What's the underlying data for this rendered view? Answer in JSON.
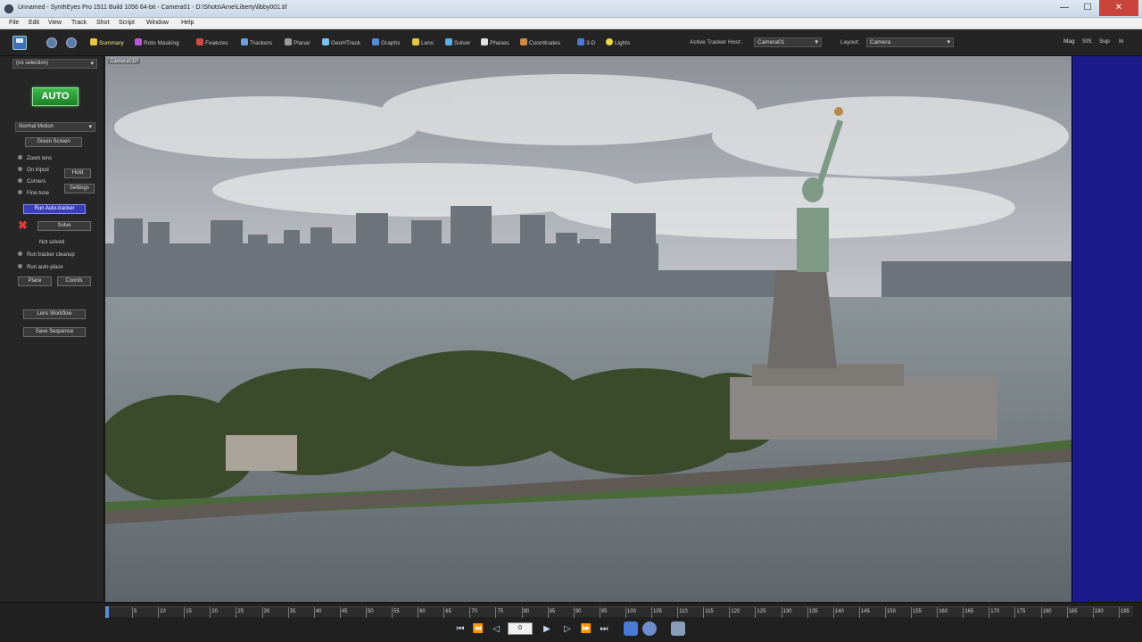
{
  "titlebar": {
    "title": "Unnamed - SynthEyes Pro 1511 Build 1056 64-bit - Camera01 - D:\\Shots\\Arne\\Liberty\\libby001.tif",
    "minimize": "—",
    "maximize": "☐",
    "close": "✕"
  },
  "menu": [
    "File",
    "Edit",
    "View",
    "Track",
    "Shot",
    "Script",
    "Window",
    "Help"
  ],
  "toolbar": {
    "rooms": [
      {
        "label": "Summary",
        "icon": "summary-icon",
        "color": "#e8c64a"
      },
      {
        "label": "Roto Masking",
        "icon": "roto-icon",
        "color": "#b85ad6"
      },
      {
        "label": "Features",
        "icon": "features-icon",
        "color": "#d04a4a"
      },
      {
        "label": "Trackers",
        "icon": "trackers-icon",
        "color": "#6aa0e0"
      },
      {
        "label": "Planar",
        "icon": "planar-icon",
        "color": "#9a9a9a"
      },
      {
        "label": "GeoHTrack",
        "icon": "geohtrack-icon",
        "color": "#7ac0e8"
      },
      {
        "label": "Graphs",
        "icon": "graphs-icon",
        "color": "#5a8ad6"
      },
      {
        "label": "Lens",
        "icon": "lens-icon",
        "color": "#e0c84a"
      },
      {
        "label": "Solver",
        "icon": "solver-icon",
        "color": "#5ab0e0"
      },
      {
        "label": "Phases",
        "icon": "phases-icon",
        "color": "#e0e0e0"
      },
      {
        "label": "Coordinates",
        "icon": "coordinates-icon",
        "color": "#d08a4a"
      },
      {
        "label": "3-D",
        "icon": "3d-icon",
        "color": "#4a7ad6"
      },
      {
        "label": "Lights",
        "icon": "lights-icon",
        "color": "#e8d84a"
      }
    ],
    "active_tracker_host_label": "Active Tracker Host:",
    "active_tracker_host_value": "Camera01",
    "layout_label": "Layout:",
    "layout_value": "Camera",
    "right_buttons": [
      "Mag",
      "SIS",
      "Sup",
      "In"
    ]
  },
  "leftpanel": {
    "selection": "(no selection)",
    "auto_label": "AUTO",
    "motion_profile": "Normal Motion",
    "green_screen": "Green Screen",
    "options": [
      "Zoom lens",
      "On tripod",
      "Corners",
      "Fine tune"
    ],
    "hold": "Hold",
    "settings": "Settings",
    "run_auto_tracker": "Run Auto-tracker",
    "solve": "Solve",
    "status": "Not solved",
    "post_options": [
      "Run tracker cleanup",
      "Run auto-place"
    ],
    "place": "Place",
    "coords": "Coords",
    "lens_workflow": "Lens Workflow",
    "save_sequence": "Save Sequence"
  },
  "viewport": {
    "label": "Camera01P",
    "accent_strip": "#1a1a8a"
  },
  "timeline": {
    "ticks": [
      "5",
      "10",
      "15",
      "20",
      "25",
      "30",
      "35",
      "40",
      "45",
      "50",
      "55",
      "60",
      "65",
      "70",
      "75",
      "80",
      "85",
      "90",
      "95",
      "100",
      "105",
      "110",
      "115",
      "120",
      "125",
      "130",
      "135",
      "140",
      "145",
      "150",
      "155",
      "160",
      "165",
      "170",
      "175",
      "180",
      "185",
      "190",
      "195"
    ],
    "current_frame": "0",
    "transport": [
      "⏮",
      "⏪",
      "◁",
      "▶",
      "▷",
      "⏩",
      "⏭"
    ]
  }
}
